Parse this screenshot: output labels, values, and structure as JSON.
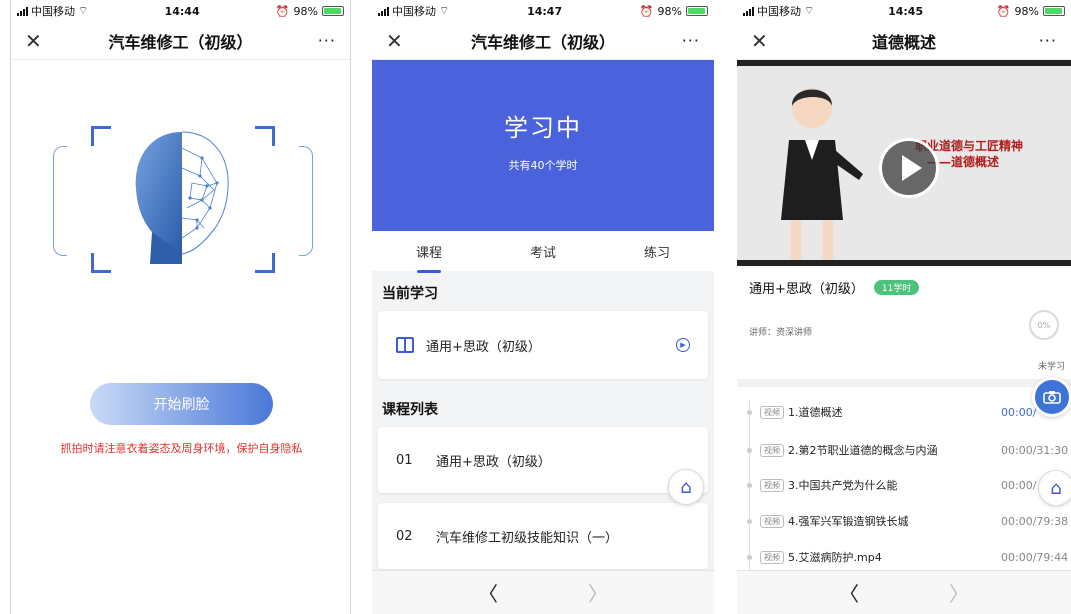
{
  "status_bars": [
    {
      "carrier": "中国移动",
      "time": "14:44",
      "battery": "98%"
    },
    {
      "carrier": "中国移动",
      "time": "14:47",
      "battery": "98%"
    },
    {
      "carrier": "中国移动",
      "time": "14:45",
      "battery": "98%"
    }
  ],
  "screen1": {
    "nav_title": "汽车维修工（初级）",
    "close_glyph": "✕",
    "more_glyph": "···",
    "start_button": "开始刷脸",
    "notice": "抓拍时请注意衣着姿态及周身环境，保护自身隐私"
  },
  "screen2": {
    "nav_title": "汽车维修工（初级）",
    "close_glyph": "✕",
    "more_glyph": "···",
    "hero_title": "学习中",
    "hero_sub": "共有40个学时",
    "tabs": [
      "课程",
      "考试",
      "练习"
    ],
    "current_section": "当前学习",
    "current_course": "通用+思政（初级）",
    "list_section": "课程列表",
    "courses": [
      {
        "num": "01",
        "name": "通用+思政（初级）"
      },
      {
        "num": "02",
        "name": "汽车维修工初级技能知识（一）"
      }
    ],
    "back_glyph": "〈",
    "forward_glyph": "〉"
  },
  "screen3": {
    "nav_title": "道德概述",
    "close_glyph": "✕",
    "more_glyph": "···",
    "video_title_line1": "职业道德与工匠精神",
    "video_title_line2": "——道德概述",
    "course_name": "通用+思政（初级）",
    "hours_badge": "11学时",
    "lecturer": "讲师：资深讲师",
    "progress_percent": "0%",
    "progress_label": "未学习",
    "lessons": [
      {
        "tag": "视频",
        "title": "1.道德概述",
        "time": "00:00/"
      },
      {
        "tag": "视频",
        "title": "2.第2节职业道德的概念与内涵",
        "time": "00:00/31:30"
      },
      {
        "tag": "视频",
        "title": "3.中国共产党为什么能",
        "time": "00:00/"
      },
      {
        "tag": "视频",
        "title": "4.强军兴军锻造钢铁长城",
        "time": "00:00/79:38"
      },
      {
        "tag": "视频",
        "title": "5.艾滋病防护.mp4",
        "time": "00:00/79:44"
      }
    ],
    "back_glyph": "〈",
    "forward_glyph": "〉"
  },
  "colors": {
    "accent": "#3d5bd8",
    "hero": "#4a62dc",
    "warning": "#e0332e",
    "badge": "#4cc37a"
  }
}
